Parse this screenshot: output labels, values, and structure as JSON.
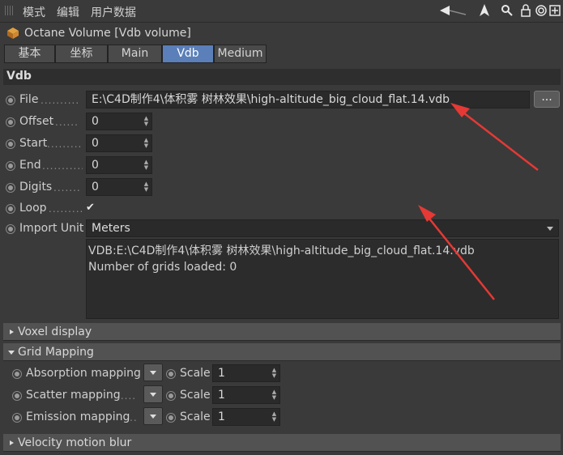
{
  "menu": {
    "items": [
      "模式",
      "编辑",
      "用户数据"
    ]
  },
  "object": {
    "title": "Octane Volume [Vdb volume]"
  },
  "tabs": [
    "基本",
    "坐标",
    "Main",
    "Vdb",
    "Medium"
  ],
  "active_tab": "Vdb",
  "section": {
    "title": "Vdb"
  },
  "vdb": {
    "file_label": "File",
    "file_dots": "..........",
    "file_value": "E:\\C4D制作4\\体积雾 树林效果\\high-altitude_big_cloud_flat.14.vdb",
    "browse_label": "...",
    "offset_label": "Offset",
    "offset_dots": "......",
    "offset_value": "0",
    "start_label": "Start",
    "start_dots": ".........",
    "start_value": "0",
    "end_label": "End",
    "end_dots": "...........",
    "end_value": "0",
    "digits_label": "Digits",
    "digits_dots": ".......",
    "digits_value": "0",
    "loop_label": "Loop",
    "loop_dots": ".........",
    "loop_checked": "✔",
    "import_unit_label": "Import Unit",
    "import_unit_value": "Meters",
    "info_line1": "VDB:E:\\C4D制作4\\体积雾 树林效果\\high-altitude_big_cloud_flat.14.vdb",
    "info_line2": "Number of grids loaded: 0"
  },
  "groups": {
    "voxel_display": "Voxel display",
    "grid_mapping": "Grid Mapping",
    "velocity_motion_blur": "Velocity motion blur"
  },
  "grid_mapping": {
    "absorption_label": "Absorption mapping",
    "scatter_label": "Scatter mapping",
    "scatter_dots": ".....",
    "emission_label": "Emission mapping",
    "emission_dots": "..",
    "scale_label": "Scale",
    "absorption_scale": "1",
    "scatter_scale": "1",
    "emission_scale": "1"
  },
  "colors": {
    "accent_tab": "#5b7fb8",
    "annotation_arrow": "#e53935"
  }
}
